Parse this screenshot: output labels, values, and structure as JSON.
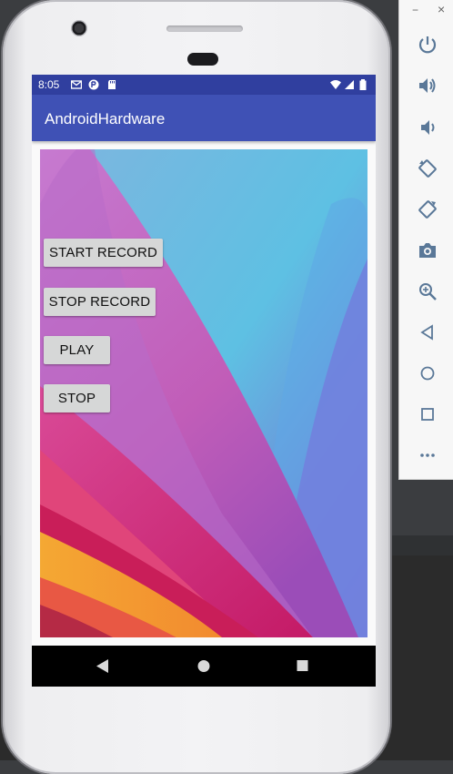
{
  "status_bar": {
    "time": "8:05",
    "left_icons": [
      "gmail-icon",
      "notification-icon",
      "sd-card-icon"
    ],
    "right_icons": [
      "wifi-icon",
      "signal-icon",
      "battery-icon"
    ]
  },
  "app": {
    "title": "AndroidHardware"
  },
  "buttons": {
    "start_record": "START RECORD",
    "stop_record": "STOP RECORD",
    "play": "PLAY",
    "stop": "STOP"
  },
  "nav_bar": {
    "icons": [
      "back-icon",
      "home-icon",
      "recents-icon"
    ]
  },
  "emulator_panel": {
    "window_controls": [
      "minimize-icon",
      "close-icon"
    ],
    "window_control_glyphs": {
      "minimize": "−",
      "close": "×"
    },
    "tools": [
      "power-icon",
      "volume-up-icon",
      "volume-down-icon",
      "rotate-left-icon",
      "rotate-right-icon",
      "screenshot-icon",
      "zoom-icon",
      "back-icon",
      "home-icon",
      "overview-icon",
      "more-icon"
    ]
  },
  "colors": {
    "status_bar": "#303f9f",
    "app_bar": "#3f51b5",
    "button_bg": "#d6d7d7"
  }
}
